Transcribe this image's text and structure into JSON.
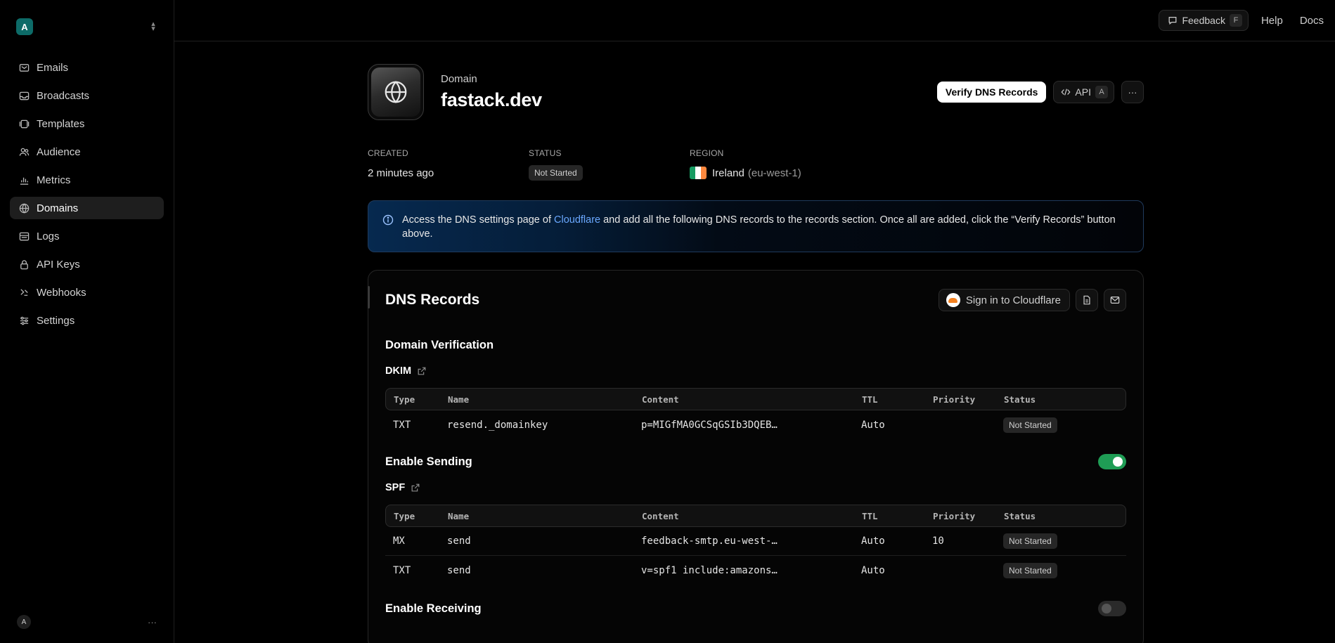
{
  "sidebar": {
    "team_initial": "A",
    "items": [
      {
        "label": "Emails",
        "icon": "mail-icon"
      },
      {
        "label": "Broadcasts",
        "icon": "inbox-icon"
      },
      {
        "label": "Templates",
        "icon": "templates-icon"
      },
      {
        "label": "Audience",
        "icon": "users-icon"
      },
      {
        "label": "Metrics",
        "icon": "chart-icon"
      },
      {
        "label": "Domains",
        "icon": "globe-icon",
        "active": true
      },
      {
        "label": "Logs",
        "icon": "logs-icon"
      },
      {
        "label": "API Keys",
        "icon": "lock-icon"
      },
      {
        "label": "Webhooks",
        "icon": "webhook-icon"
      },
      {
        "label": "Settings",
        "icon": "sliders-icon"
      }
    ],
    "user_initial": "A",
    "user_more": "···"
  },
  "topbar": {
    "feedback_label": "Feedback",
    "feedback_key": "F",
    "help_label": "Help",
    "docs_label": "Docs"
  },
  "header": {
    "eyebrow": "Domain",
    "domain_name": "fastack.dev",
    "verify_label": "Verify DNS Records",
    "api_label": "API",
    "api_key": "A",
    "more_label": "···"
  },
  "meta": {
    "created_label": "CREATED",
    "created_value": "2 minutes ago",
    "status_label": "STATUS",
    "status_value": "Not Started",
    "region_label": "REGION",
    "region_name": "Ireland",
    "region_code": "(eu-west-1)",
    "flag_colors": [
      "#169b62",
      "#ffffff",
      "#ff883e"
    ]
  },
  "notice": {
    "text_before": "Access the DNS settings page of ",
    "link": "Cloudflare",
    "text_after": " and add all the following DNS records to the records section. Once all are added, click the “Verify Records” button above."
  },
  "records": {
    "title": "DNS Records",
    "cloudflare_label": "Sign in to Cloudflare",
    "columns": [
      "Type",
      "Name",
      "Content",
      "TTL",
      "Priority",
      "Status"
    ],
    "verification": {
      "title": "Domain Verification",
      "subtitle": "DKIM",
      "rows": [
        {
          "type": "TXT",
          "name": "resend._domainkey",
          "content": "p=MIGfMA0GCSqGSIb3DQEB…",
          "ttl": "Auto",
          "priority": "",
          "status": "Not Started"
        }
      ]
    },
    "sending": {
      "title": "Enable Sending",
      "enabled": true,
      "subtitle": "SPF",
      "rows": [
        {
          "type": "MX",
          "name": "send",
          "content": "feedback-smtp.eu-west-…",
          "ttl": "Auto",
          "priority": "10",
          "status": "Not Started"
        },
        {
          "type": "TXT",
          "name": "send",
          "content": "v=spf1 include:amazons…",
          "ttl": "Auto",
          "priority": "",
          "status": "Not Started"
        }
      ]
    },
    "receiving": {
      "title": "Enable Receiving",
      "enabled": false
    }
  }
}
